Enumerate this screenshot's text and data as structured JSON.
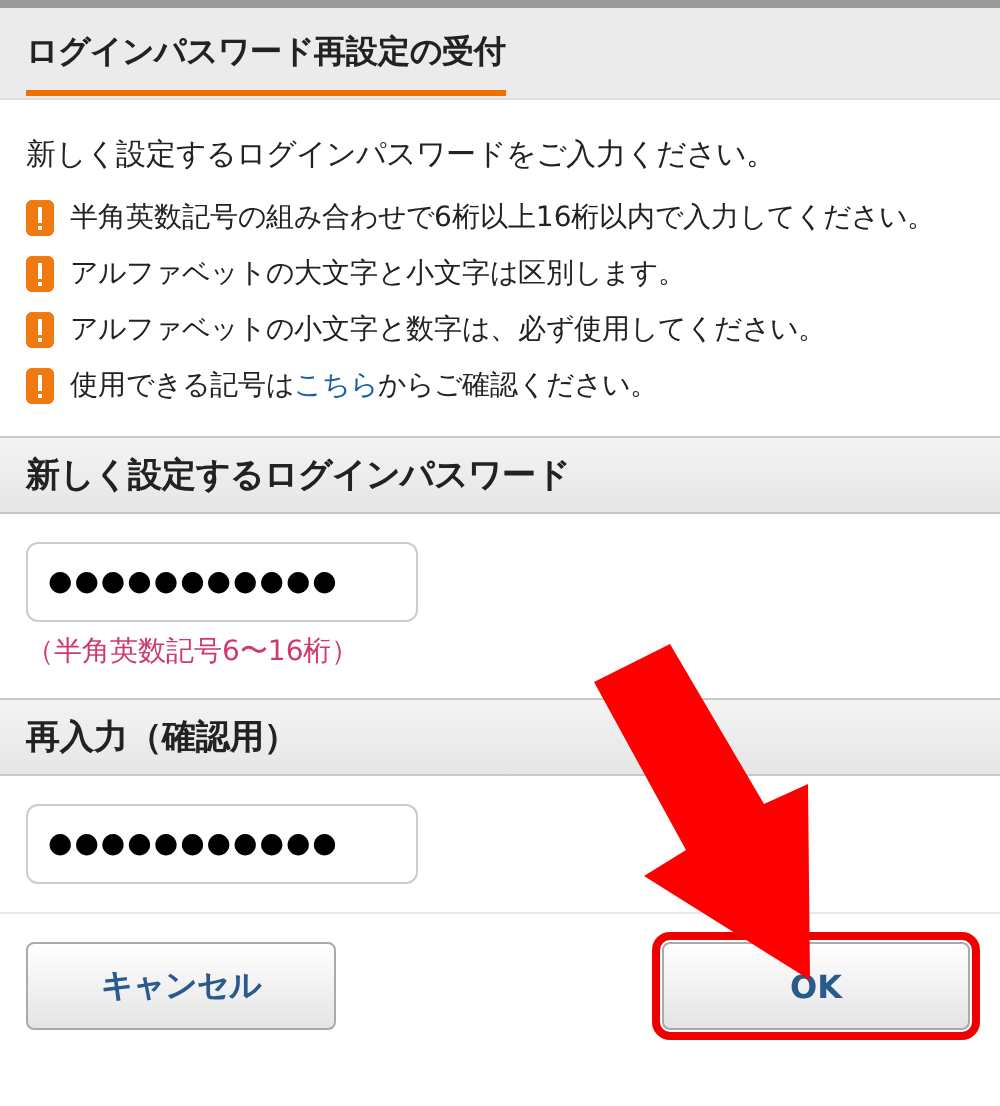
{
  "title": "ログインパスワード再設定の受付",
  "intro": "新しく設定するログインパスワードをご入力ください。",
  "notes": [
    {
      "text": "半角英数記号の組み合わせで6桁以上16桁以内で入力してください。"
    },
    {
      "text": "アルファベットの大文字と小文字は区別します。"
    },
    {
      "text": "アルファベットの小文字と数字は、必ず使用してください。"
    },
    {
      "text": "使用できる記号は",
      "link": "こちら",
      "text_after": "からご確認ください。"
    }
  ],
  "fields": [
    {
      "label": "新しく設定するログインパスワード",
      "value": "●●●●●●●●●●●",
      "hint": "（半角英数記号6〜16桁）"
    },
    {
      "label": "再入力（確認用）",
      "value": "●●●●●●●●●●●"
    }
  ],
  "buttons": [
    {
      "label": "キャンセル",
      "highlighted": false
    },
    {
      "label": "OK",
      "highlighted": true
    }
  ]
}
